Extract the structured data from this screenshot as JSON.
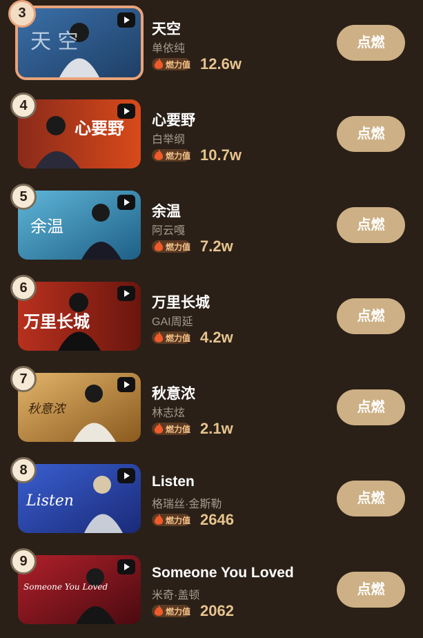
{
  "heat_badge_label": "燃力值",
  "ignite_label": "点燃",
  "colors": {
    "background": "#2a2018",
    "button": "#cdb085",
    "value_text": "#e7c48e",
    "top_border": "#e9a37a"
  },
  "items": [
    {
      "rank": "3",
      "title": "天空",
      "artist": "单依纯",
      "heat": "12.6w",
      "thumb_text": "天 空"
    },
    {
      "rank": "4",
      "title": "心要野",
      "artist": "白举纲",
      "heat": "10.7w",
      "thumb_text": "心要野"
    },
    {
      "rank": "5",
      "title": "余温",
      "artist": "阿云嘎",
      "heat": "7.2w",
      "thumb_text": "余温"
    },
    {
      "rank": "6",
      "title": "万里长城",
      "artist": "GAI周延",
      "heat": "4.2w",
      "thumb_text": "万里长城"
    },
    {
      "rank": "7",
      "title": "秋意浓",
      "artist": "林志炫",
      "heat": "2.1w",
      "thumb_text": "秋意浓"
    },
    {
      "rank": "8",
      "title": "Listen",
      "artist": "格瑞丝·金斯勒",
      "heat": "2646",
      "thumb_text": "Listen"
    },
    {
      "rank": "9",
      "title": "Someone You Loved",
      "artist": "米奇·盖顿",
      "heat": "2062",
      "thumb_text": "Someone You Loved"
    }
  ]
}
